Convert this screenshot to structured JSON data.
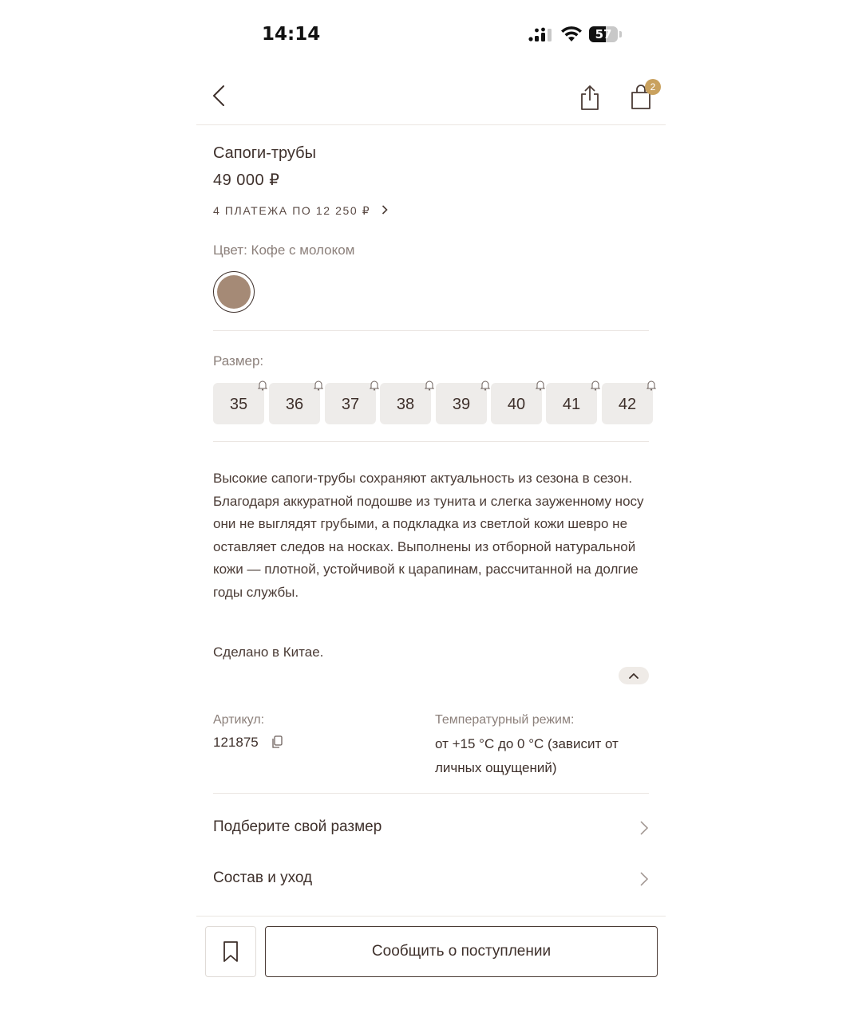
{
  "status_bar": {
    "time": "14:14",
    "battery": "57",
    "battery_level": 0.57
  },
  "header": {
    "cart_count": "2"
  },
  "product": {
    "title": "Сапоги-трубы",
    "price": "49 000 ₽",
    "installments": "4 ПЛАТЕЖА ПО 12 250 ₽",
    "color_label": "Цвет: Кофе с молоком",
    "color_hex": "#a58a76",
    "size_label": "Размер:",
    "sizes": [
      "35",
      "36",
      "37",
      "38",
      "39",
      "40",
      "41",
      "42"
    ],
    "description": "Высокие сапоги-трубы сохраняют актуальность из сезона в сезон. Благодаря аккуратной подошве из тунита и слегка зауженному носу они не выглядят грубыми, а подкладка из светлой кожи шевро не оставляет следов на носках. Выполнены из отборной натуральной кожи — плотной, устойчивой к царапинам, рассчитанной на долгие годы службы.",
    "made_in": "Сделано в Китае.",
    "article_label": "Артикул:",
    "article_value": "121875",
    "temperature_label": "Температурный режим:",
    "temperature_value": "от +15 °C до 0 °C (зависит от личных ощущений)"
  },
  "links": {
    "size_guide": "Подберите свой размер",
    "composition": "Состав и уход"
  },
  "actions": {
    "notify": "Сообщить о поступлении"
  },
  "colors": {
    "text": "#3e302b",
    "muted": "#8c807b",
    "badge": "#c9a15e",
    "size_bg": "#eeecea"
  }
}
